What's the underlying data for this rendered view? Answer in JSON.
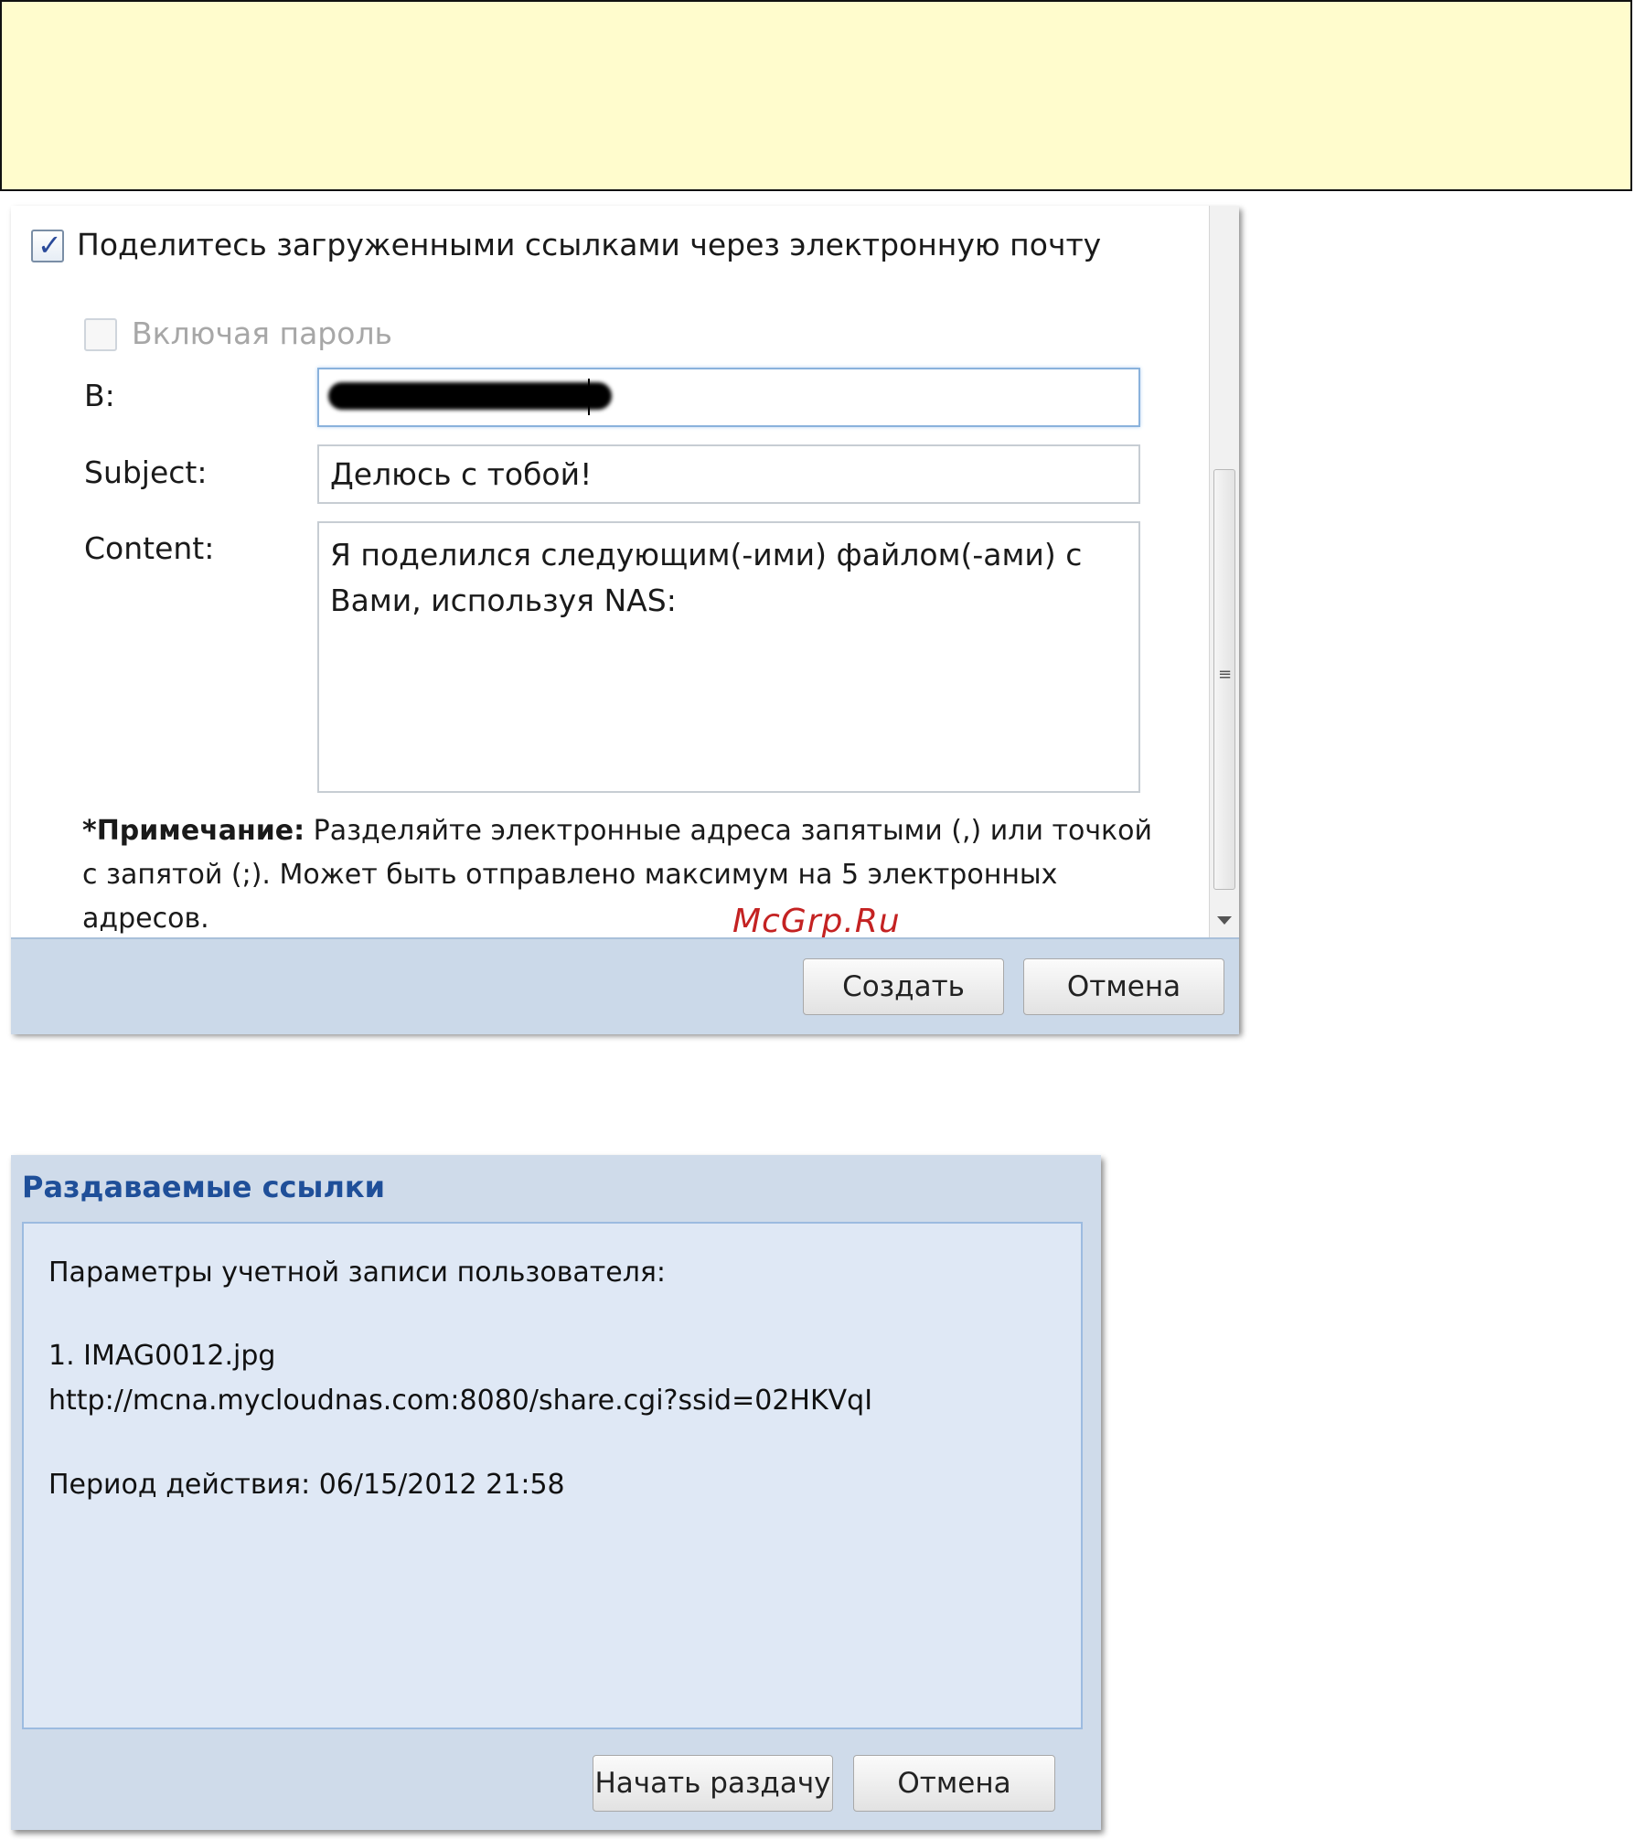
{
  "share_email_dialog": {
    "share_via_email_label": "Поделитесь загруженными ссылками через электронную почту",
    "share_via_email_checked": true,
    "include_password_label": "Включая пароль",
    "include_password_checked": false,
    "to_label": "В:",
    "subject_label": "Subject:",
    "subject_value": "Делюсь с тобой!",
    "content_label": "Content:",
    "content_value": "Я поделился следующим(-ими) файлом(-ами) с Вами, используя NAS:",
    "note_bold": "*Примечание:",
    "note_text": " Разделяйте электронные адреса запятыми (,) или точкой с запятой (;). Может быть отправлено максимум на 5 электронных адресов.",
    "create_button": "Создать",
    "cancel_button": "Отмена",
    "watermark": "McGrp.Ru"
  },
  "share_links_dialog": {
    "title": "Раздаваемые ссылки",
    "account_params_label": "Параметры учетной записи пользователя:",
    "file_entry": "1. IMAG0012.jpg",
    "link_url": "http://mcna.mycloudnas.com:8080/share.cgi?ssid=02HKVqI",
    "validity_label": "Период действия: 06/15/2012 21:58",
    "start_sharing_button": "Начать раздачу",
    "cancel_button": "Отмена"
  },
  "colors": {
    "note_background": "#fffccd",
    "dialog_footer": "#cbd9e9",
    "title_blue": "#1f4f99",
    "watermark_red": "#c42222"
  }
}
